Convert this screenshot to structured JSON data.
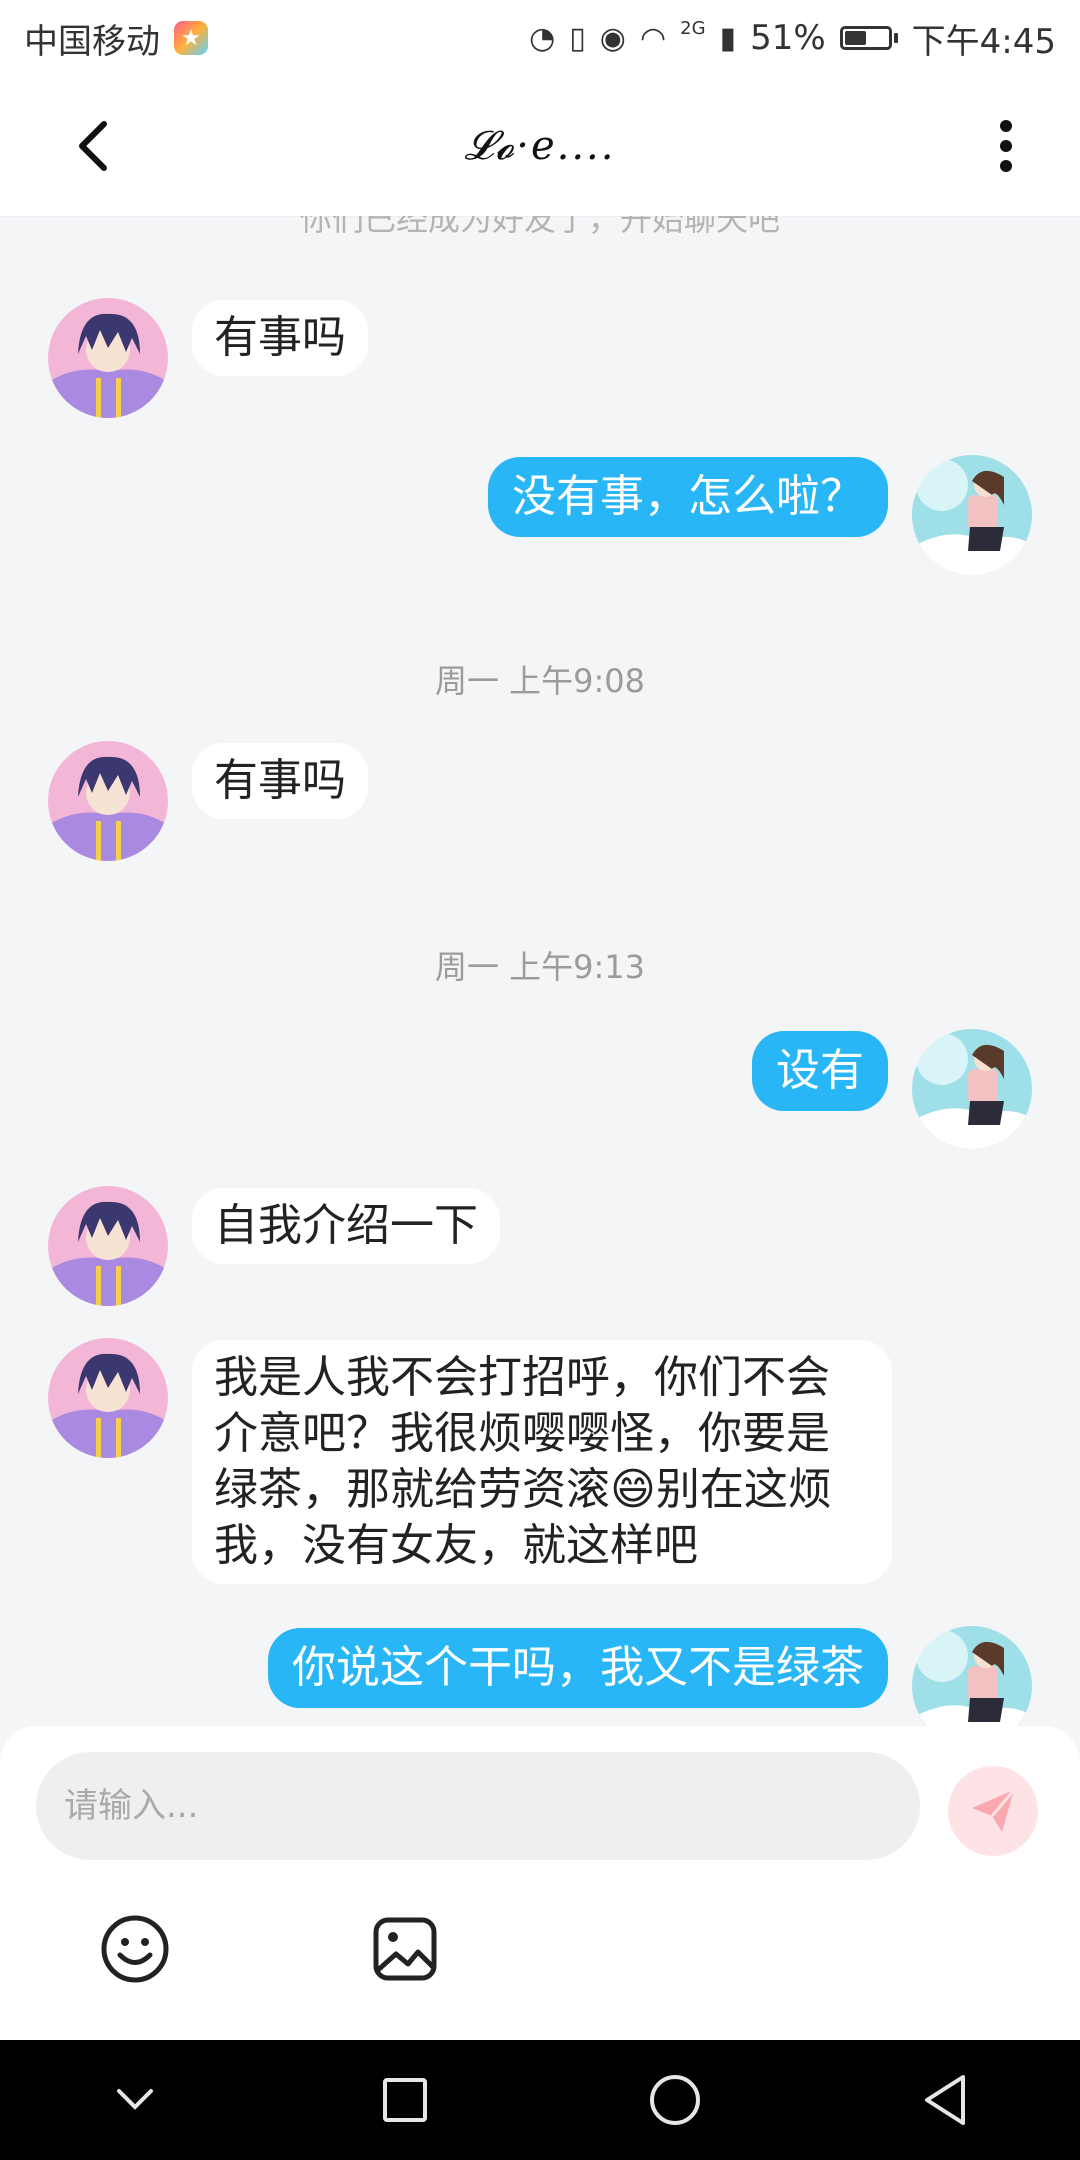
{
  "status_bar": {
    "carrier": "中国移动",
    "network": "2G",
    "battery": "51%",
    "battery_level": 0.51,
    "time": "下午4:45"
  },
  "header": {
    "title": "𝓛𝓸·e...."
  },
  "chat": {
    "system_note": "你们已经成为好友了，开始聊天吧",
    "items": [
      {
        "type": "message",
        "side": "in",
        "text": "有事吗"
      },
      {
        "type": "message",
        "side": "out",
        "text": "没有事，怎么啦？"
      },
      {
        "type": "timestamp",
        "text": "周一 上午9:08"
      },
      {
        "type": "message",
        "side": "in",
        "text": "有事吗"
      },
      {
        "type": "timestamp",
        "text": "周一 上午9:13"
      },
      {
        "type": "message",
        "side": "out",
        "text": "设有"
      },
      {
        "type": "message",
        "side": "in",
        "text": "自我介绍一下"
      },
      {
        "type": "message",
        "side": "in",
        "text": "我是人我不会打招呼，你们不会介意吧？我很烦嘤嘤怪，你要是绿茶，那就给劳资滚😄别在这烦我，没有女友，就这样吧"
      },
      {
        "type": "message",
        "side": "out",
        "text": "你说这个干吗，我又不是绿茶"
      }
    ]
  },
  "composer": {
    "placeholder": "请输入...",
    "value": ""
  },
  "colors": {
    "outgoing_bubble": "#29b6f6",
    "incoming_bubble": "#ffffff",
    "send_button": "#fde3e6",
    "send_icon": "#f9a8b0"
  },
  "icons": {
    "back": "back-arrow-icon",
    "more": "more-vertical-icon",
    "send": "send-icon",
    "emoji": "smiley-icon",
    "image": "image-icon"
  }
}
